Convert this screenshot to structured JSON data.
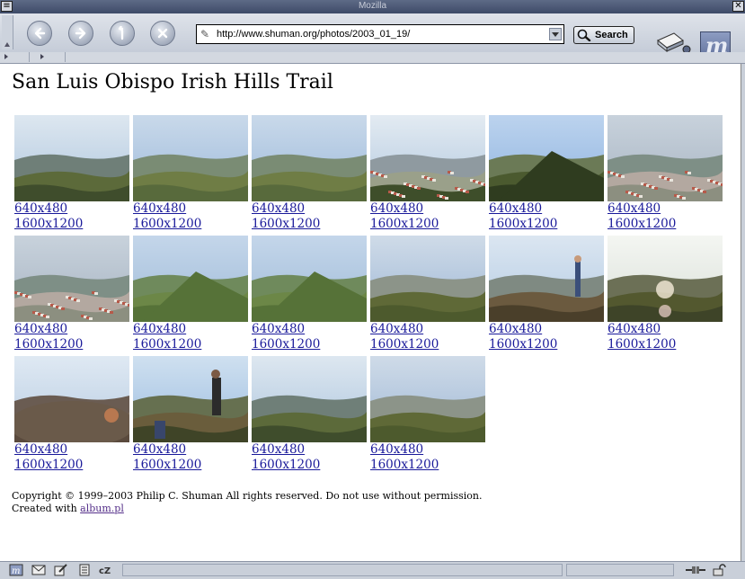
{
  "window": {
    "title": "Mozilla"
  },
  "toolbar": {
    "url": "http://www.shuman.org/photos/2003_01_19/",
    "search_label": "Search"
  },
  "page": {
    "title": "San Luis Obispo Irish Hills Trail",
    "photos": [
      {
        "small": "640x480",
        "large": "1600x1200",
        "scene": "dusk"
      },
      {
        "small": "640x480",
        "large": "1600x1200",
        "scene": "valley"
      },
      {
        "small": "640x480",
        "large": "1600x1200",
        "scene": "valley"
      },
      {
        "small": "640x480",
        "large": "1600x1200",
        "scene": "town"
      },
      {
        "small": "640x480",
        "large": "1600x1200",
        "scene": "hill"
      },
      {
        "small": "640x480",
        "large": "1600x1200",
        "scene": "town2"
      },
      {
        "small": "640x480",
        "large": "1600x1200",
        "scene": "town2"
      },
      {
        "small": "640x480",
        "large": "1600x1200",
        "scene": "peak"
      },
      {
        "small": "640x480",
        "large": "1600x1200",
        "scene": "peak"
      },
      {
        "small": "640x480",
        "large": "1600x1200",
        "scene": "scrub"
      },
      {
        "small": "640x480",
        "large": "1600x1200",
        "scene": "person"
      },
      {
        "small": "640x480",
        "large": "1600x1200",
        "scene": "flare"
      },
      {
        "small": "640x480",
        "large": "1600x1200",
        "scene": "rocks"
      },
      {
        "small": "640x480",
        "large": "1600x1200",
        "scene": "hikers"
      },
      {
        "small": "640x480",
        "large": "1600x1200",
        "scene": "dusk"
      },
      {
        "small": "640x480",
        "large": "1600x1200",
        "scene": "scrub"
      }
    ],
    "footer": {
      "copyright": "Copyright © 1999–2003 Philip C. Shuman All rights reserved. Do not use without permission.",
      "created_prefix": "Created with",
      "created_link": "album.pl"
    }
  },
  "colors": {
    "link": "#1a1a9a",
    "visited": "#55308a",
    "chrome": "#c9cfd9"
  }
}
